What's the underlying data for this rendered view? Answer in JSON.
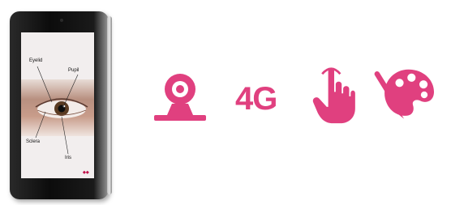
{
  "device": {
    "screen_labels": {
      "eyelid": "Eyelid",
      "pupil": "Pupil",
      "sclera": "Sclera",
      "iris": "Iris"
    }
  },
  "features": [
    {
      "icon": "webcam-icon"
    },
    {
      "icon": "4g-icon",
      "label": "4G"
    },
    {
      "icon": "touch-hand-icon"
    },
    {
      "icon": "paint-palette-icon"
    }
  ],
  "colors": {
    "accent": "#e0407f",
    "device": "#111111"
  }
}
